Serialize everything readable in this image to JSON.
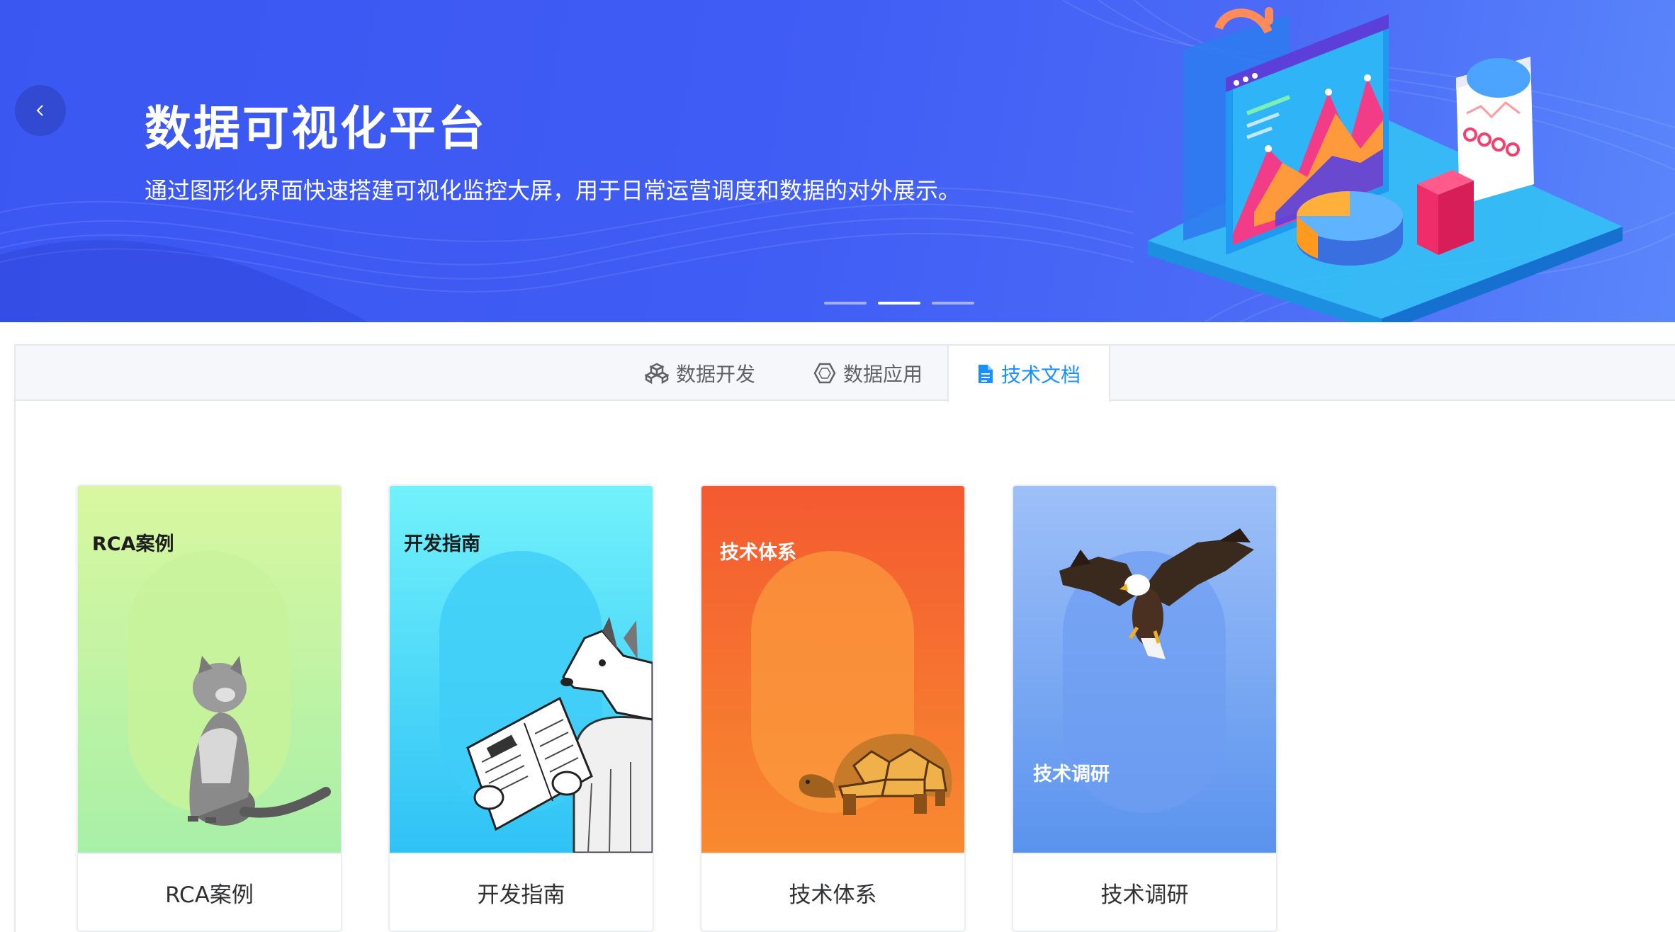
{
  "banner": {
    "title": "数据可视化平台",
    "subtitle": "通过图形化界面快速搭建可视化监控大屏，用于日常运营调度和数据的对外展示。",
    "prev_icon": "chevron-left-icon",
    "slides_total": 3,
    "active_slide": 2
  },
  "tabs": [
    {
      "label": "数据开发",
      "icon": "cubes-icon",
      "active": false
    },
    {
      "label": "数据应用",
      "icon": "hexagon-icon",
      "active": false
    },
    {
      "label": "技术文档",
      "icon": "document-icon",
      "active": true
    }
  ],
  "cards": [
    {
      "image_label": "RCA案例",
      "title": "RCA案例",
      "animal": "cat"
    },
    {
      "image_label": "开发指南",
      "title": "开发指南",
      "animal": "wolf"
    },
    {
      "image_label": "技术体系",
      "title": "技术体系",
      "animal": "tortoise"
    },
    {
      "image_label": "技术调研",
      "title": "技术调研",
      "animal": "eagle"
    }
  ],
  "colors": {
    "banner": "#3f5cf4",
    "accent": "#1890ff",
    "text": "#303133",
    "muted": "#606266"
  }
}
